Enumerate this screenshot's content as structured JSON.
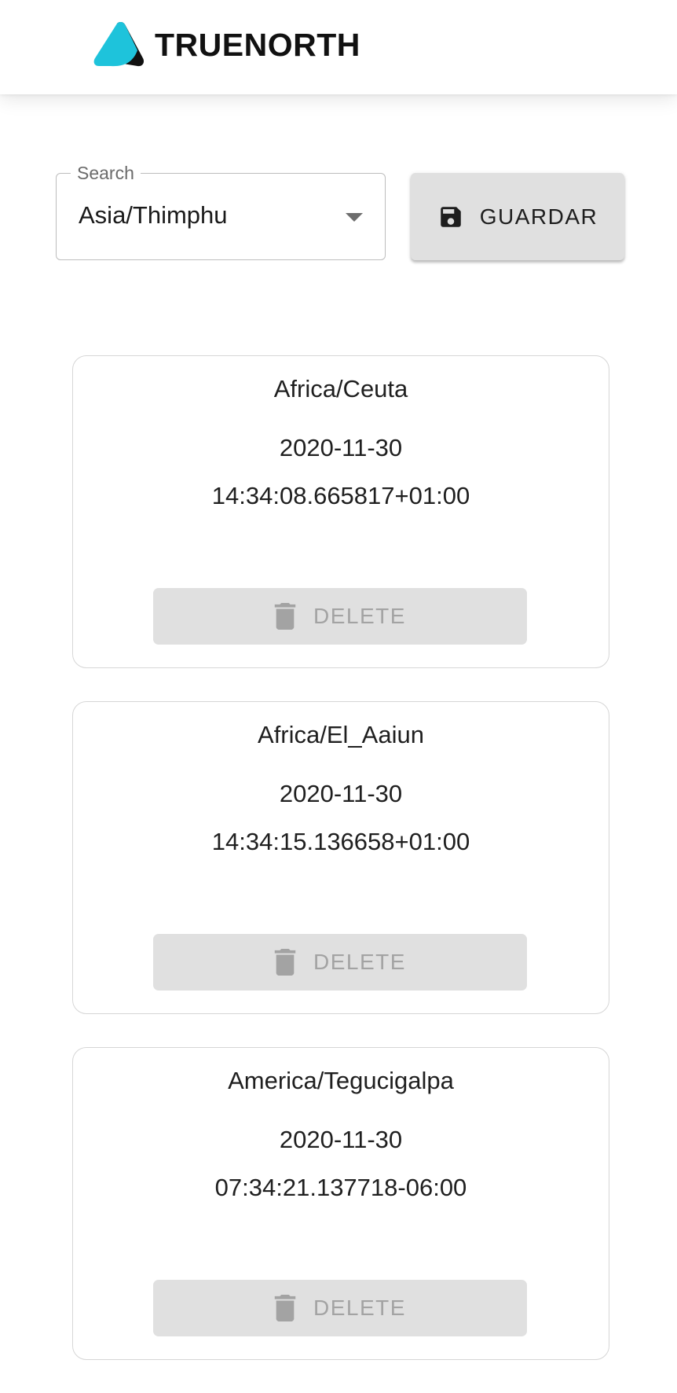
{
  "header": {
    "brand": "TRUENORTH",
    "logo_icon": "truenorth-logo-icon",
    "brand_colors": {
      "primary": "#1ec3db",
      "dark": "#111111"
    }
  },
  "toolbar": {
    "search": {
      "label": "Search",
      "value": "Asia/Thimphu",
      "dropdown_icon": "arrow-drop-down-icon"
    },
    "save_button": {
      "label": "GUARDAR",
      "icon": "save-icon"
    }
  },
  "cards": [
    {
      "zone": "Africa/Ceuta",
      "date": "2020-11-30",
      "time": "14:34:08.665817+01:00",
      "delete_label": "DELETE",
      "delete_icon": "trash-icon"
    },
    {
      "zone": "Africa/El_Aaiun",
      "date": "2020-11-30",
      "time": "14:34:15.136658+01:00",
      "delete_label": "DELETE",
      "delete_icon": "trash-icon"
    },
    {
      "zone": "America/Tegucigalpa",
      "date": "2020-11-30",
      "time": "07:34:21.137718-06:00",
      "delete_label": "DELETE",
      "delete_icon": "trash-icon"
    }
  ],
  "colors": {
    "button_bg": "#e0e0e0",
    "disabled_text": "#a3a3a3",
    "card_border": "#d6d6d6"
  }
}
